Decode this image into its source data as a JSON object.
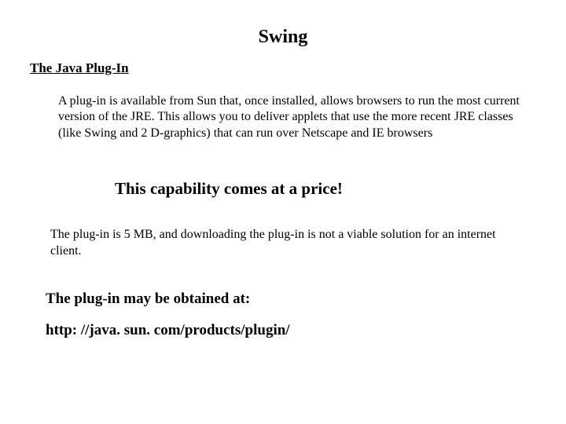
{
  "title": "Swing",
  "section_heading": "The Java Plug-In",
  "paragraph_1": "A plug-in is available from Sun that, once installed, allows browsers to run the most current version of the JRE.  This allows you to deliver applets that use the more recent JRE classes (like Swing and 2 D-graphics) that can run over Netscape and IE browsers",
  "callout": "This capability comes at a price!",
  "paragraph_2": "The plug-in is 5 MB, and downloading the plug-in is not a viable solution for an internet client.",
  "obtained_at": "The plug-in may be obtained at:",
  "url": "http: //java. sun. com/products/plugin/"
}
